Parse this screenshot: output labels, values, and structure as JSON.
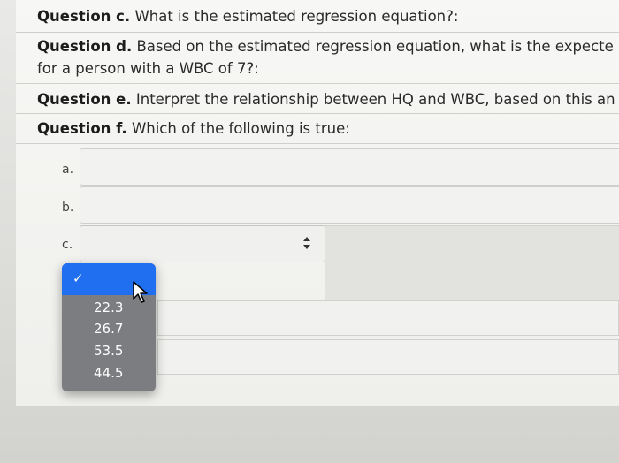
{
  "questions": {
    "c": {
      "label": "Question c.",
      "text": " What is the estimated regression equation?:"
    },
    "d": {
      "label": "Question d.",
      "text": " Based on the estimated regression equation, what is the expecte",
      "text2": "for a person with a WBC of 7?:"
    },
    "e": {
      "label": "Question e.",
      "text": " Interpret the relationship between HQ and WBC, based on this an"
    },
    "f": {
      "label": "Question f.",
      "text": " Which of the following is true:"
    }
  },
  "options": {
    "a": "a.",
    "b": "b.",
    "c": "c."
  },
  "dropdown": {
    "check": "✓",
    "items": [
      "22.3",
      "26.7",
      "53.5",
      "44.5"
    ]
  },
  "select_arrows": "▲▼"
}
